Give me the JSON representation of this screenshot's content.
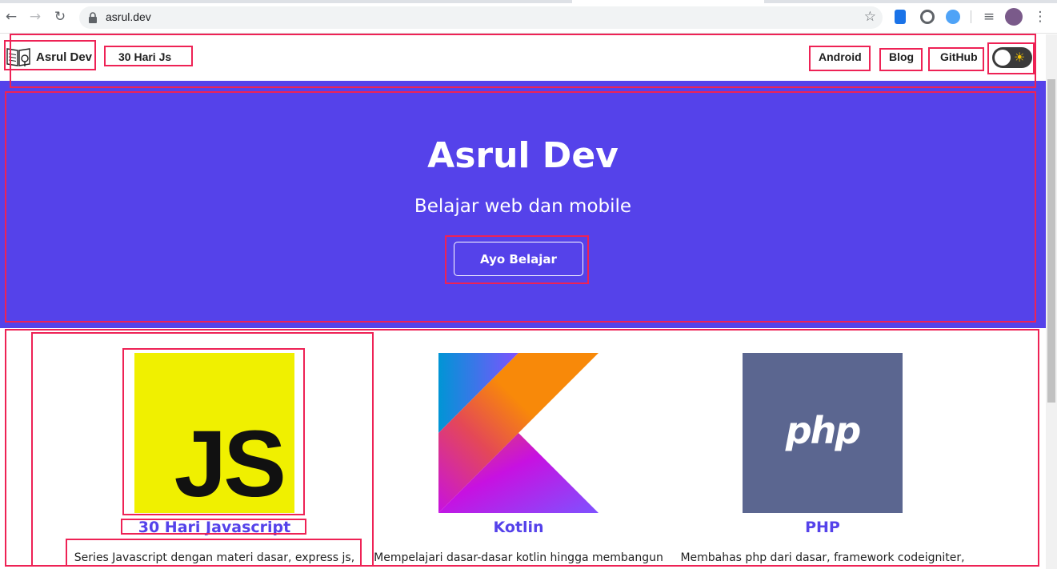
{
  "browser": {
    "url": "asrul.dev",
    "back_icon": "arrow-left-icon",
    "forward_icon": "arrow-right-icon",
    "reload_icon": "reload-icon"
  },
  "navbar": {
    "brand_label": "Asrul Dev",
    "left_links": [
      "30 Hari Js"
    ],
    "right_links": [
      "Android",
      "Blog",
      "GitHub"
    ],
    "theme_toggle_icon": "sun-icon",
    "theme_toggle_on": false
  },
  "hero": {
    "title": "Asrul Dev",
    "subtitle": "Belajar web dan mobile",
    "button_label": "Ayo Belajar",
    "background": "#5542ea"
  },
  "cards": [
    {
      "logo_text": "JS",
      "title": "30 Hari Javascript",
      "description": "Series Javascript dengan materi dasar, express js,",
      "logo_color": "#f0f000"
    },
    {
      "title": "Kotlin",
      "description": "Mempelajari dasar-dasar kotlin hingga membangun",
      "logo_name": "kotlin-logo"
    },
    {
      "logo_text": "php",
      "title": "PHP",
      "description": "Membahas php dari dasar, framework codeigniter,",
      "logo_color": "#5b6690"
    }
  ],
  "colors": {
    "accent": "#5542ea",
    "annotation": "#ee2255"
  }
}
